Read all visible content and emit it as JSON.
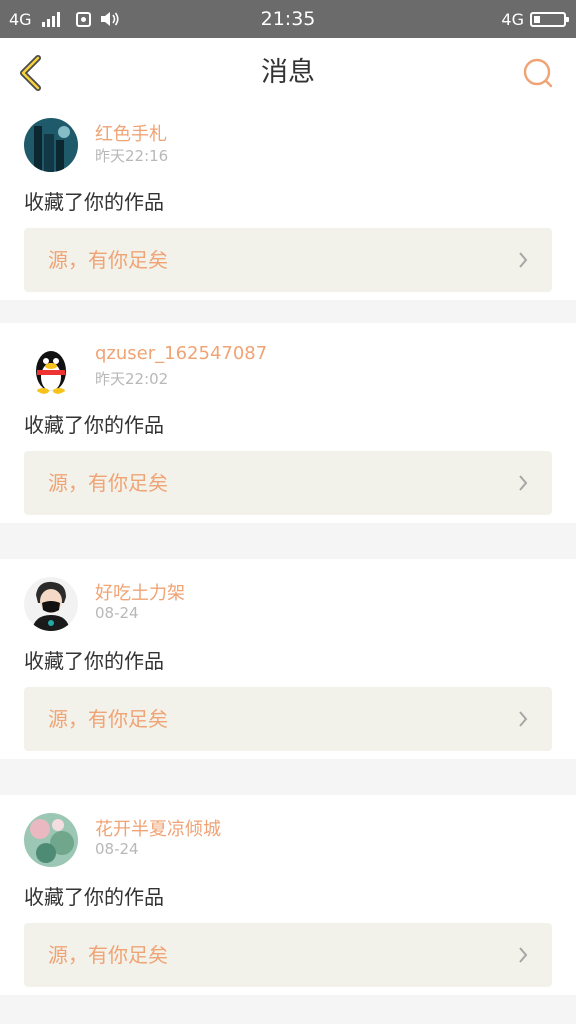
{
  "status_bar": {
    "network_left": "4G",
    "time": "21:35",
    "network_right": "4G",
    "icons": [
      "signal-icon",
      "app-notification-icon",
      "vibrate-icon",
      "battery-icon"
    ]
  },
  "header": {
    "title": "消息",
    "back_icon": "chevron-left-icon",
    "search_icon": "search-icon",
    "accent_color": "#f0a374"
  },
  "messages": [
    {
      "username": "红色手札",
      "time": "昨天22:16",
      "action": "收藏了你的作品",
      "work_title": "源，有你足矣",
      "avatar": "city-night-avatar"
    },
    {
      "username": "qzuser_162547087",
      "time": "昨天22:02",
      "action": "收藏了你的作品",
      "work_title": "源，有你足矣",
      "avatar": "penguin-avatar"
    },
    {
      "username": "好吃土力架",
      "time": "08-24",
      "action": "收藏了你的作品",
      "work_title": "源，有你足矣",
      "avatar": "masked-person-avatar"
    },
    {
      "username": "花开半夏凉倾城",
      "time": "08-24",
      "action": "收藏了你的作品",
      "work_title": "源，有你足矣",
      "avatar": "floral-avatar"
    }
  ]
}
